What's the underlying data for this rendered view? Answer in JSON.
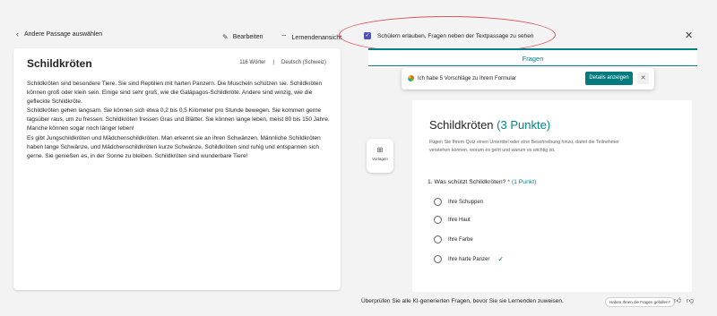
{
  "toolbar": {
    "back_label": "Andere Passage auswählen",
    "edit_label": "Bearbeiten",
    "learner_view_label": "Lernendenansicht",
    "allow_questions_label": "Schülern erlauben, Fragen neben der Textpassage zu sehen",
    "allow_questions_checked": true
  },
  "passage": {
    "title": "Schildkröten",
    "word_count": "116 Wörter",
    "separator": "|",
    "language": "Deutsch (Schweiz)",
    "paragraphs": [
      "Schildkröten sind besondere Tiere. Sie sind Reptilien mit harten Panzern. Die Muscheln schützen sie. Schildkröten können groß oder klein sein. Einige sind sehr groß, wie die Galápagos-Schildkröte. Andere sind winzig, wie die gefleckte Schildkröte.",
      "Schildkröten gehen langsam. Sie können sich etwa 0,2 bis 0,5 Kilometer pro Stunde bewegen. Sie kommen gerne tagsüber raus, um zu fressen. Schildkröten fressen Gras und Blätter. Sie können lange leben, meist 80 bis 150 Jahre. Manche können sogar noch länger leben!",
      "Es gibt Jungschildkröten und Mädchenschildkröten. Man erkennt sie an ihren Schwänzen. Männliche Schildkröten haben lange Schwänze, und Mädchenschildkröten kurze Schwänze. Schildkröten sind ruhig und entspannen sich gerne. Sie genießen es, in der Sonne zu bleiben. Schildkröten sind wunderbare Tiere!"
    ]
  },
  "panel": {
    "tab_label": "Fragen",
    "suggestion_text": "Ich habe 5 Vorschläge zu Ihrem Formular",
    "details_button": "Details anzeigen",
    "templates_label": "Vorlagen",
    "form_title": "Schildkröten",
    "form_points": "(3 Punkte)",
    "form_description": "Fügen Sie Ihrem Quiz einen Untertitel oder eine Beschreibung hinzu, damit die Teilnehmer verstehen können, worum es geht und warum es wichtig ist.",
    "question": {
      "text": "1. Was schützt Schildkröten?",
      "required_mark": "*",
      "points": "(1 Punkt)",
      "options": [
        "Ihre Schuppen",
        "Ihre Haut",
        "Ihre Farbe",
        "Ihre harte Panzer"
      ],
      "correct_index": 3
    }
  },
  "footer": {
    "review_text": "Überprüfen Sie alle KI-generierten Fragen, bevor Sie sie Lernenden zuweisen.",
    "feedback_question": "Haben Ihnen die Fragen gefallen?"
  },
  "colors": {
    "accent": "#038387",
    "checkbox": "#4f52b2",
    "annotation": "#d9535a"
  }
}
